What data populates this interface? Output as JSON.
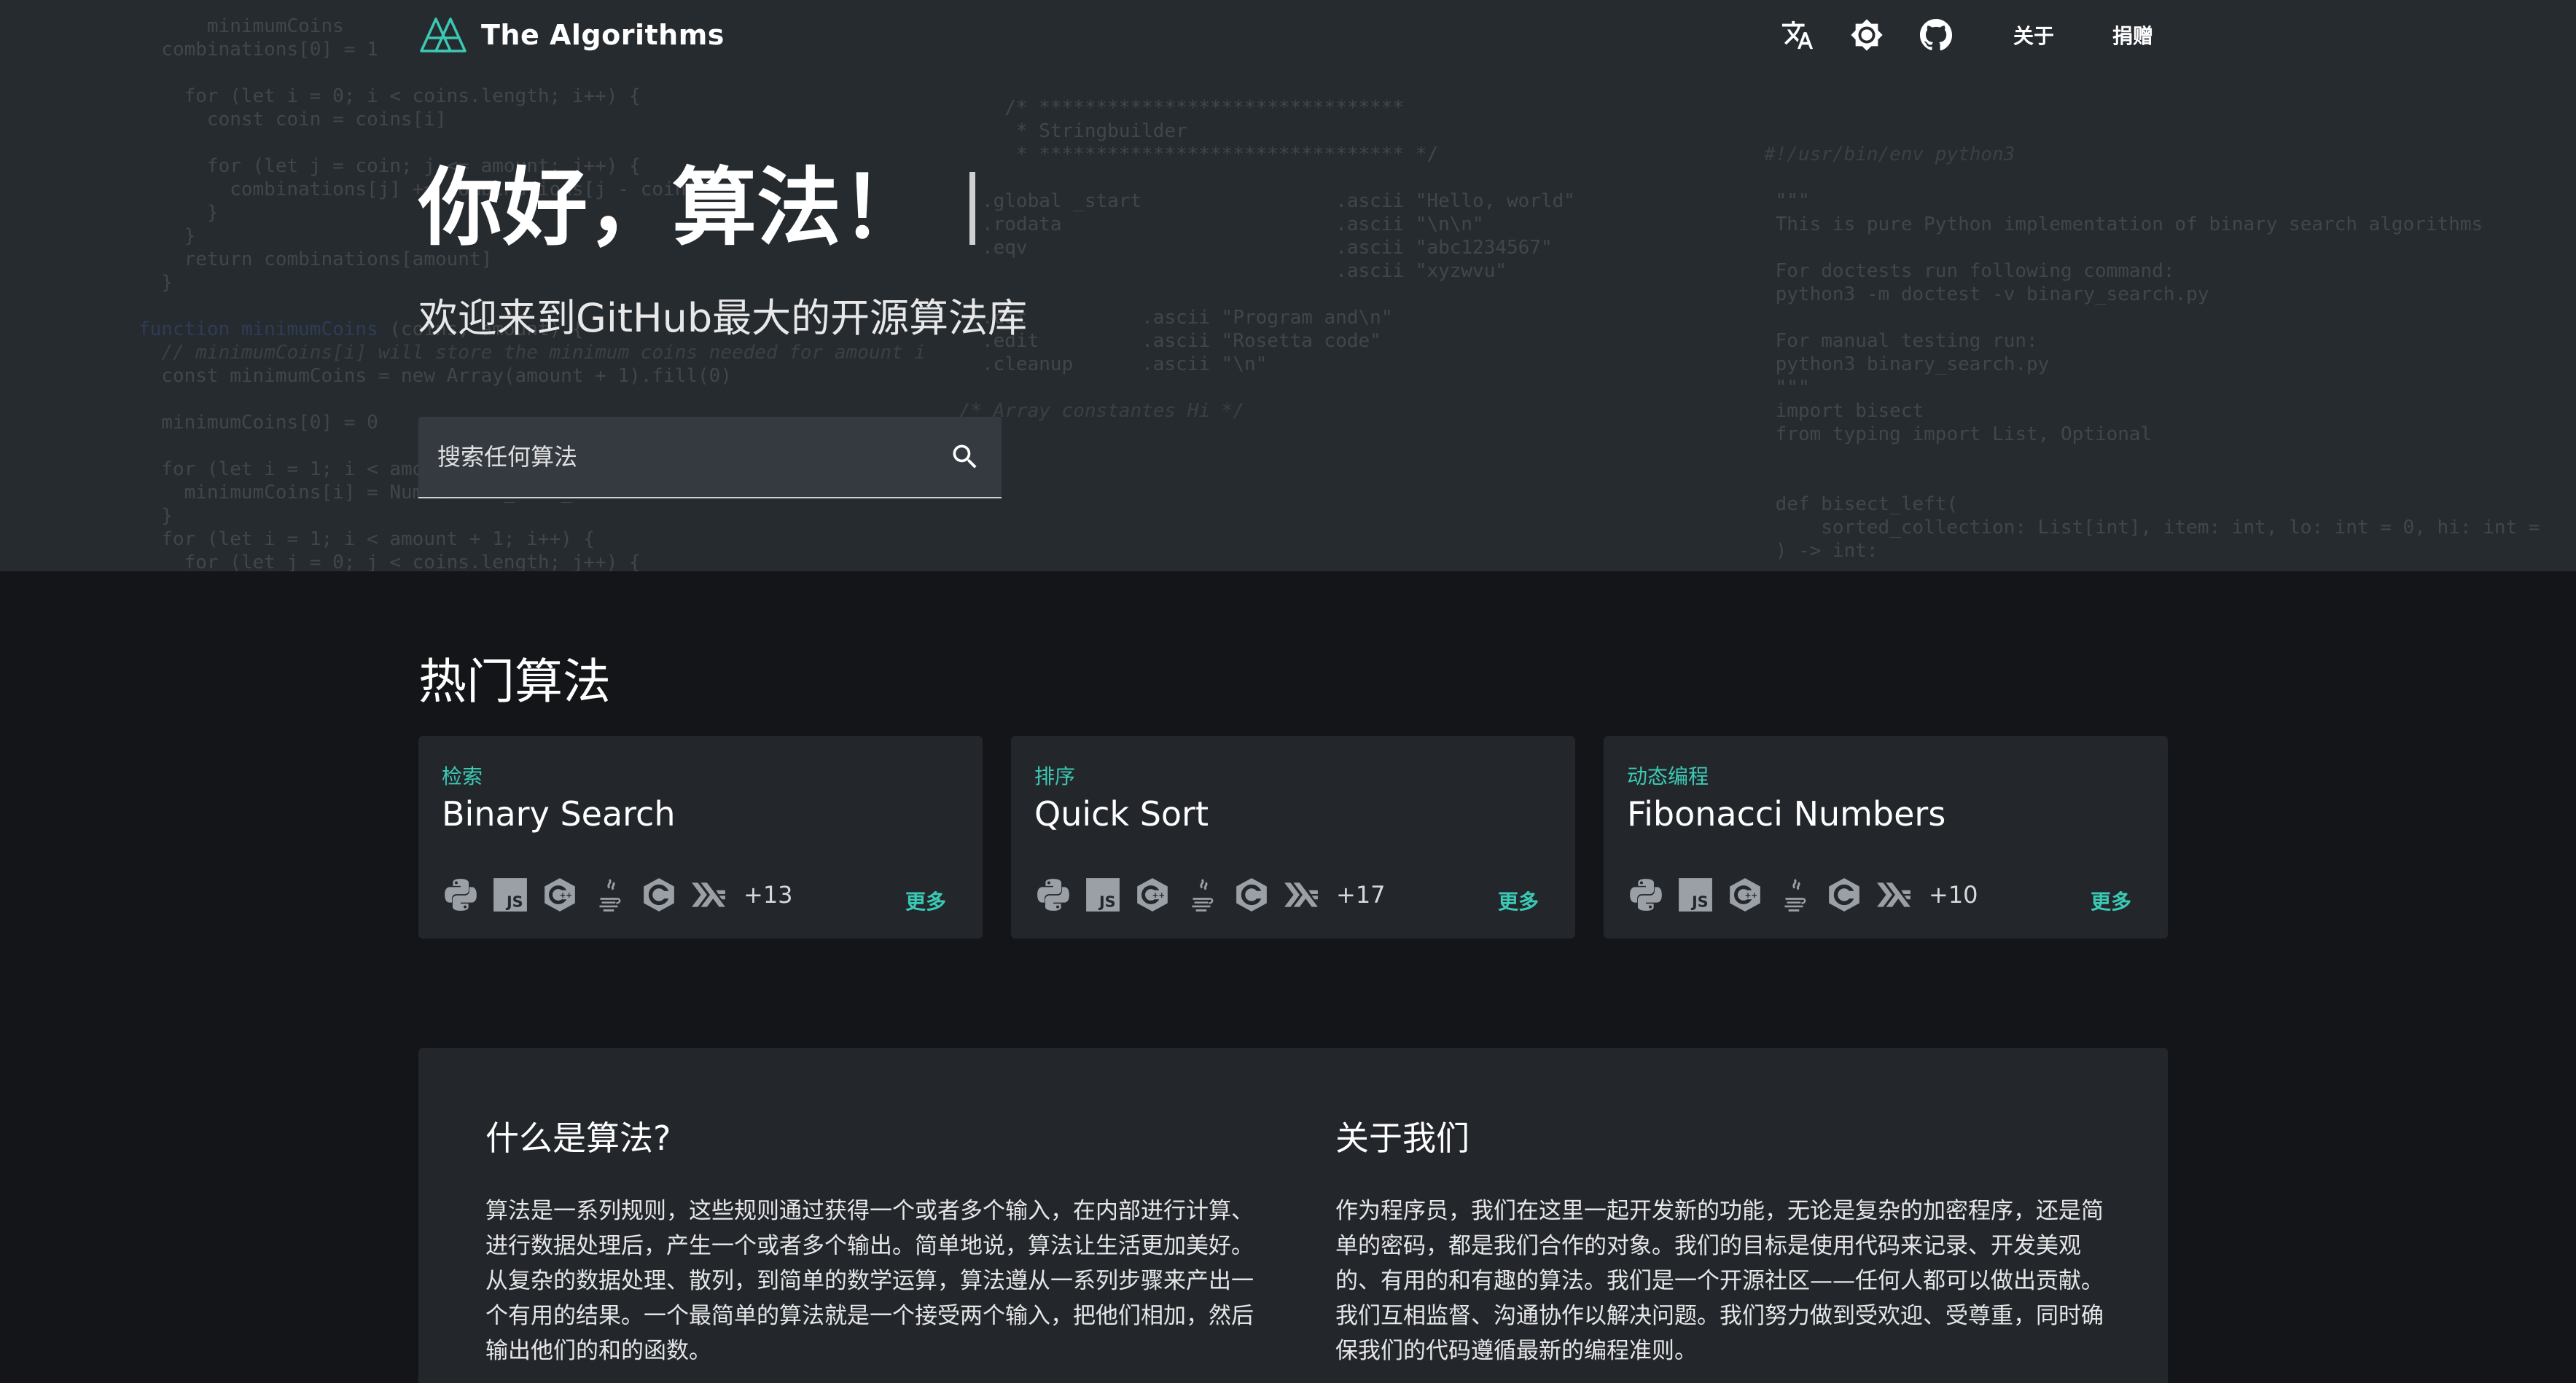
{
  "navbar": {
    "brand_name": "The Algorithms",
    "icons": [
      "translate-icon",
      "theme-icon",
      "github-icon"
    ],
    "links": [
      "关于",
      "捐赠"
    ]
  },
  "hero": {
    "title": "你好，算法！",
    "subtitle": "欢迎来到GitHub最大的开源算法库",
    "search_placeholder": "搜索任何算法"
  },
  "popular": {
    "title": "热门算法",
    "cards": [
      {
        "category": "检索",
        "title": "Binary Search",
        "more_count": "+13",
        "more_label": "更多"
      },
      {
        "category": "排序",
        "title": "Quick Sort",
        "more_count": "+17",
        "more_label": "更多"
      },
      {
        "category": "动态编程",
        "title": "Fibonacci Numbers",
        "more_count": "+10",
        "more_label": "更多"
      }
    ],
    "languages": [
      "python-icon",
      "javascript-icon",
      "cpp-icon",
      "java-icon",
      "c-icon",
      "haskell-icon"
    ]
  },
  "info": {
    "what_title": "什么是算法?",
    "what_text": "算法是一系列规则，这些规则通过获得一个或者多个输入，在内部进行计算、进行数据处理后，产生一个或者多个输出。简单地说，算法让生活更加美好。从复杂的数据处理、散列，到简单的数学运算，算法遵从一系列步骤来产出一个有用的结果。一个最简单的算法就是一个接受两个输入，把他们相加，然后输出他们的和的函数。",
    "about_title": "关于我们",
    "about_text": "作为程序员，我们在这里一起开发新的功能，无论是复杂的加密程序，还是简单的密码，都是我们合作的对象。我们的目标是使用代码来记录、开发美观的、有用的和有趣的算法。我们是一个开源社区——任何人都可以做出贡献。我们互相监督、沟通协作以解决问题。我们努力做到受欢迎、受尊重，同时确保我们的代码遵循最新的编程准则。"
  },
  "colors": {
    "hero_bg": "#262b30",
    "page_bg": "#131519",
    "card_bg": "#23272c",
    "accent": "#3bc9b4"
  }
}
